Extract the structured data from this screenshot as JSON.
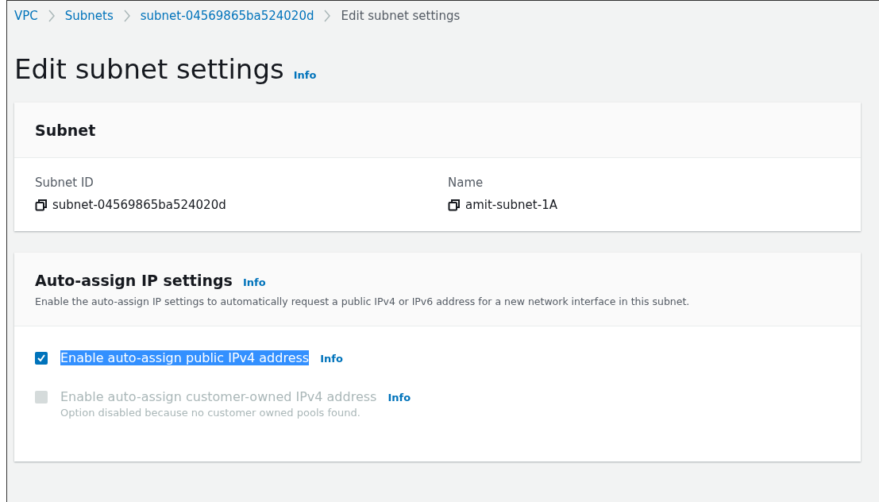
{
  "breadcrumbs": [
    {
      "label": "VPC",
      "current": false
    },
    {
      "label": "Subnets",
      "current": false
    },
    {
      "label": "subnet-04569865ba524020d",
      "current": false
    },
    {
      "label": "Edit subnet settings",
      "current": true
    }
  ],
  "page_title": "Edit subnet settings",
  "page_info": "Info",
  "subnet_card": {
    "title": "Subnet",
    "fields": [
      {
        "label": "Subnet ID",
        "value": "subnet-04569865ba524020d"
      },
      {
        "label": "Name",
        "value": "amit-subnet-1A"
      }
    ]
  },
  "auto_assign_card": {
    "title": "Auto-assign IP settings",
    "info": "Info",
    "description": "Enable the auto-assign IP settings to automatically request a public IPv4 or IPv6 address for a new network interface in this subnet.",
    "options": [
      {
        "label": "Enable auto-assign public IPv4 address",
        "info": "Info",
        "checked": true,
        "disabled": false,
        "highlighted": true
      },
      {
        "label": "Enable auto-assign customer-owned IPv4 address",
        "info": "Info",
        "checked": false,
        "disabled": true,
        "highlighted": false,
        "hint": "Option disabled because no customer owned pools found."
      }
    ]
  }
}
